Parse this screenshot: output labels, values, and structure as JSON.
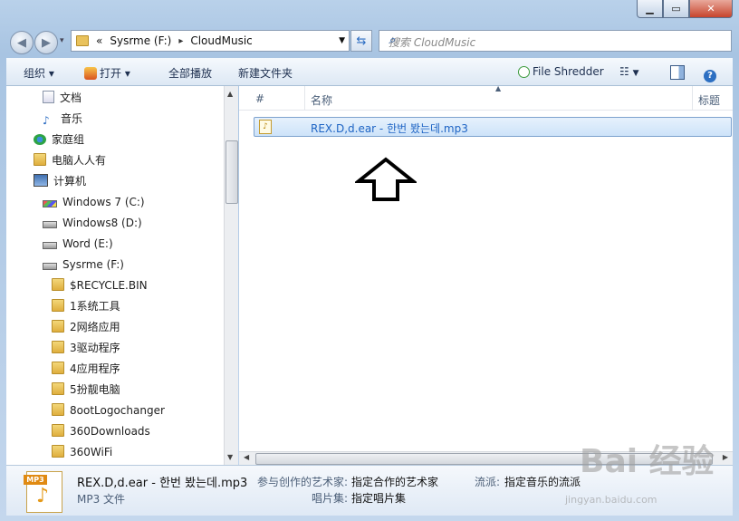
{
  "address": {
    "prefix": "«",
    "drive": "Sysrme (F:)",
    "sep": "▸",
    "folder": "CloudMusic"
  },
  "search": {
    "placeholder": "搜索 CloudMusic"
  },
  "toolbar": {
    "organize": "组织 ▾",
    "open": "打开 ▾",
    "play_all": "全部播放",
    "new_folder": "新建文件夹",
    "shredder": "File Shredder"
  },
  "nav": {
    "items": [
      {
        "label": "文档",
        "icon": "document-icon"
      },
      {
        "label": "音乐",
        "icon": "music-icon"
      },
      {
        "label": "家庭组",
        "icon": "homegroup-icon"
      },
      {
        "label": "电脑人人有",
        "icon": "folder-icon"
      },
      {
        "label": "计算机",
        "icon": "computer-icon"
      },
      {
        "label": "Windows 7  (C:)",
        "icon": "windows-drive-icon"
      },
      {
        "label": "Windows8 (D:)",
        "icon": "drive-icon"
      },
      {
        "label": "Word (E:)",
        "icon": "drive-icon"
      },
      {
        "label": "Sysrme (F:)",
        "icon": "drive-icon"
      },
      {
        "label": "$RECYCLE.BIN",
        "icon": "folder-icon"
      },
      {
        "label": "1系统工具",
        "icon": "folder-icon"
      },
      {
        "label": "2网络应用",
        "icon": "folder-icon"
      },
      {
        "label": "3驱动程序",
        "icon": "folder-icon"
      },
      {
        "label": "4应用程序",
        "icon": "folder-icon"
      },
      {
        "label": "5扮靓电脑",
        "icon": "folder-icon"
      },
      {
        "label": "8ootLogochanger",
        "icon": "folder-icon"
      },
      {
        "label": "360Downloads",
        "icon": "folder-icon"
      },
      {
        "label": "360WiFi",
        "icon": "folder-icon"
      }
    ]
  },
  "columns": {
    "num": "#",
    "name": "名称",
    "title": "标题"
  },
  "file": {
    "name": "REX.D,d.ear - 한번 봤는데.mp3"
  },
  "details": {
    "filename": "REX.D,d.ear - 한번 봤는데.mp3",
    "type": "MP3 文件",
    "artist_label": "参与创作的艺术家:",
    "artist_value": "指定合作的艺术家",
    "album_label": "唱片集:",
    "album_value": "指定唱片集",
    "genre_label": "流派:",
    "genre_value": "指定音乐的流派",
    "icon_tag": "MP3"
  },
  "watermark": {
    "brand": "Bai 经验",
    "url": "jingyan.baidu.com"
  }
}
